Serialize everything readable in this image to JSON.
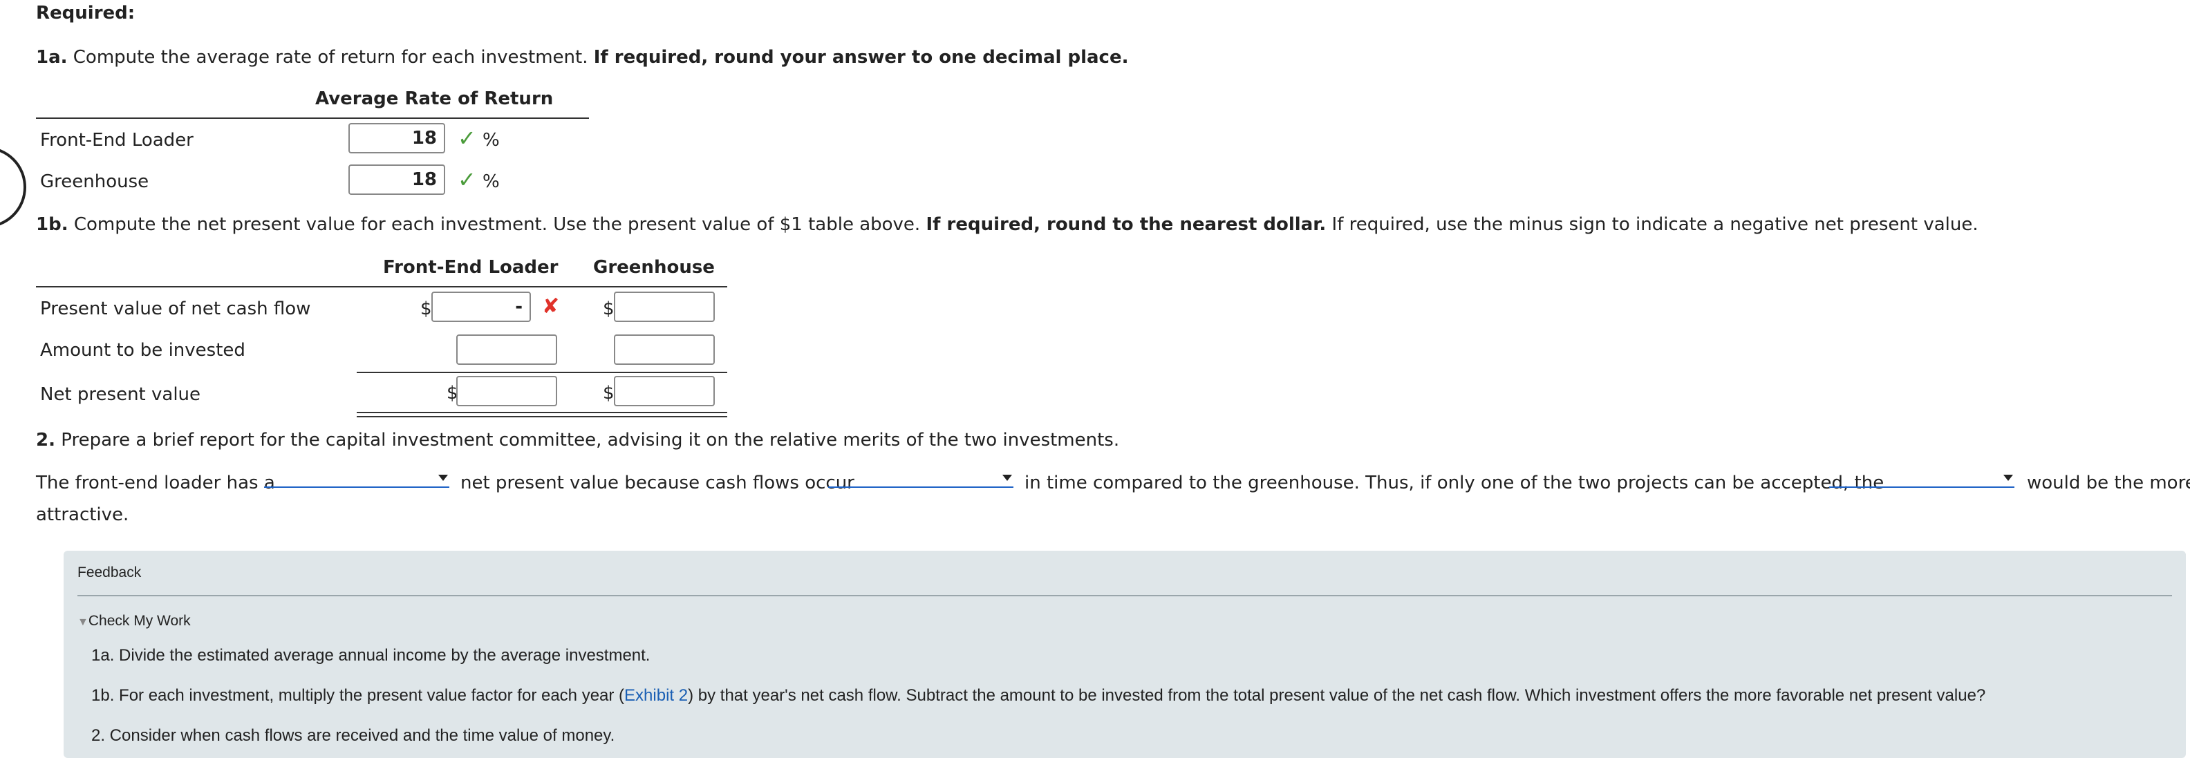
{
  "required_label": "Required:",
  "q1a": {
    "num": "1a.",
    "text": "Compute the average rate of return for each investment.",
    "bold": "If required, round your answer to one decimal place.",
    "header": "Average Rate of Return",
    "rows": [
      {
        "label": "Front-End Loader",
        "value": "18",
        "unit": "%"
      },
      {
        "label": "Greenhouse",
        "value": "18",
        "unit": "%"
      }
    ]
  },
  "q1b": {
    "num": "1b.",
    "text": "Compute the net present value for each investment. Use the present value of $1 table above.",
    "bold": "If required, round to the nearest dollar.",
    "text2": "If required, use the minus sign to indicate a negative net present value.",
    "col1": "Front-End Loader",
    "col2": "Greenhouse",
    "rows": [
      {
        "label": "Present value of net cash flow",
        "fel_value": "-",
        "gh_value": ""
      },
      {
        "label": "Amount to be invested",
        "fel_value": "",
        "gh_value": ""
      },
      {
        "label": "Net present value",
        "fel_value": "",
        "gh_value": ""
      }
    ],
    "dollar": "$"
  },
  "q2": {
    "num": "2.",
    "text": "Prepare a brief report for the capital investment committee, advising it on the relative merits of the two investments.",
    "sentence_part1": "The front-end loader has a",
    "sentence_part2": "net present value because cash flows occur",
    "sentence_part3": "in time compared to the greenhouse. Thus, if only one of the two projects can be accepted, the",
    "sentence_part4": "would be the more",
    "sentence_part5": "attractive."
  },
  "feedback": {
    "title": "Feedback",
    "check_my_work": "Check My Work",
    "line1": "1a. Divide the estimated average annual income by the average investment.",
    "line2_pre": "1b. For each investment, multiply the present value factor for each year (",
    "line2_link": "Exhibit 2",
    "line2_post": ") by that year's net cash flow. Subtract the amount to be invested from the total present value of the net cash flow. Which investment offers the more favorable net present value?",
    "line3": "2. Consider when cash flows are received and the time value of money."
  },
  "colors": {
    "check": "#4a9b3a",
    "cross": "#e0322a",
    "link": "#1a5fb4",
    "feedback_bg": "#dfe6e9"
  }
}
